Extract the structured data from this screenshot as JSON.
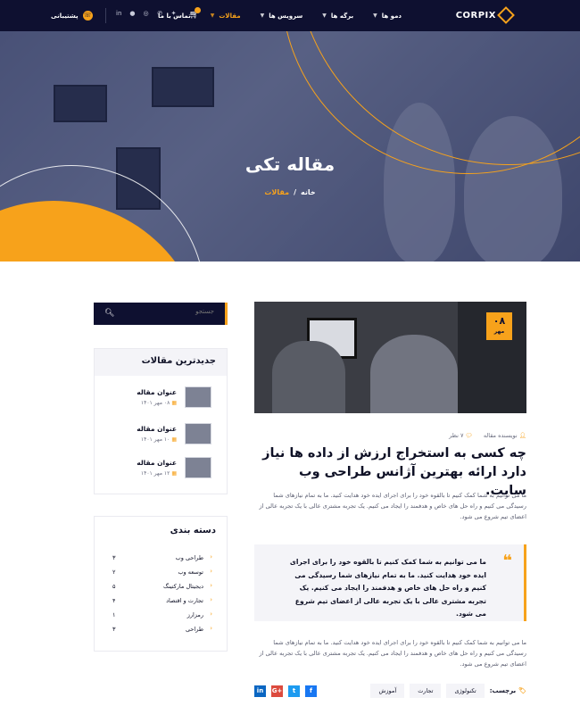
{
  "nav": {
    "logo": "CORPIX",
    "menu": [
      {
        "label": "دمو ها",
        "active": false
      },
      {
        "label": "برگه ها",
        "active": false
      },
      {
        "label": "سرویس ها",
        "active": false
      },
      {
        "label": "مقالات",
        "active": true
      },
      {
        "label": "تماس با ما",
        "active": false
      }
    ],
    "support": "پشتیبانی",
    "socials": [
      "linkedin-icon",
      "github-icon",
      "instagram-icon",
      "pinterest-icon",
      "twitter-icon"
    ]
  },
  "hero": {
    "title": "مقاله تکی",
    "breadcrumb": {
      "home": "خانه",
      "sep": "/",
      "current": "مقالات"
    }
  },
  "sidebar": {
    "search_placeholder": "جستجو",
    "recent": {
      "heading": "جدیدترین مقالات",
      "posts": [
        {
          "title": "عنوان مقاله",
          "date": "۰۸ مهر ۱۴۰۱"
        },
        {
          "title": "عنوان مقاله",
          "date": "۱۰ مهر ۱۴۰۱"
        },
        {
          "title": "عنوان مقاله",
          "date": "۱۲ مهر ۱۴۰۱"
        }
      ]
    },
    "categories": {
      "heading": "دسته بندی",
      "items": [
        {
          "name": "طراحی وب",
          "count": "۳"
        },
        {
          "name": "توسعه وب",
          "count": "۲"
        },
        {
          "name": "دیجیتال مارکتینگ",
          "count": "۵"
        },
        {
          "name": "تجارت و اقتصاد",
          "count": "۴"
        },
        {
          "name": "رمزارز",
          "count": "۱"
        },
        {
          "name": "طراحی",
          "count": "۳"
        }
      ]
    }
  },
  "article": {
    "date_day": "۰۸",
    "date_month": "مهر",
    "author": "نویسنده مقاله",
    "comments": "۷ نظر",
    "title": "چه کسی به استخراج ارزش از داده ها نیاز دارد ارائه بهترین آژانس طراحی وب سایت.",
    "para1": "ما می توانیم به شما کمک کنیم تا بالقوه خود را برای اجرای ایده خود هدایت کنید. ما به تمام نیازهای شما رسیدگی می کنیم و راه حل های خاص و هدفمند را ایجاد می کنیم. یک تجربه مشتری عالی با یک تجربه عالی از اعضای تیم شروع می شود.",
    "quote": "ما می توانیم به شما کمک کنیم تا بالقوه خود را برای اجرای ایده خود هدایت کنید. ما به تمام نیازهای شما رسیدگی می کنیم و راه حل های خاص و هدفمند را ایجاد می کنیم. یک تجربه مشتری عالی با یک تجربه عالی از اعضای تیم شروع می شود.",
    "para2": "ما می توانیم به شما کمک کنیم تا بالقوه خود را برای اجرای ایده خود هدایت کنید. ما به تمام نیازهای شما رسیدگی می کنیم و راه حل های خاص و هدفمند را ایجاد می کنیم. یک تجربه مشتری عالی با یک تجربه عالی از اعضای تیم شروع می شود.",
    "tags_label": "برچسب:",
    "tags": [
      "تکنولوژی",
      "تجارت",
      "آموزش"
    ],
    "share": [
      {
        "icon": "facebook-icon",
        "glyph": "f"
      },
      {
        "icon": "twitter-icon",
        "glyph": "t"
      },
      {
        "icon": "google-plus-icon",
        "glyph": "G+"
      },
      {
        "icon": "linkedin-icon",
        "glyph": "in"
      }
    ]
  },
  "colors": {
    "accent": "#f7a21b",
    "navy": "#0e1030"
  }
}
